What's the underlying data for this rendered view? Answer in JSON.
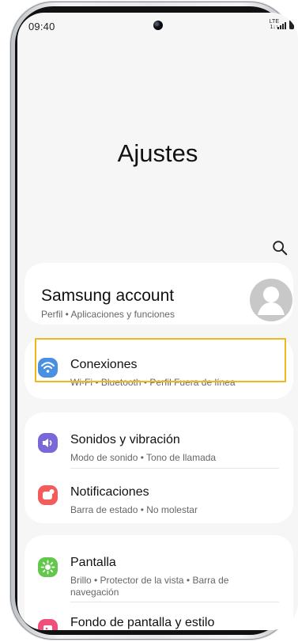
{
  "status_bar": {
    "time": "09:40",
    "network_label": "LTE",
    "network_sub": "1↓↑",
    "signal_icon": "signal-icon",
    "battery_icon": "battery-icon"
  },
  "header": {
    "title": "Ajustes"
  },
  "account": {
    "title": "Samsung account",
    "subtitle": "Perfil • Aplicaciones y funciones",
    "avatar_icon": "avatar-icon"
  },
  "settings": {
    "connections": {
      "title": "Conexiones",
      "subtitle": "Wi-Fi • Bluetooth • Perfil Fuera de línea",
      "icon": "wifi-icon",
      "color": "#4a90e2"
    },
    "sounds": {
      "title": "Sonidos y vibración",
      "subtitle": "Modo de sonido • Tono de llamada",
      "icon": "speaker-icon",
      "color": "#7a67d8"
    },
    "notifications": {
      "title": "Notificaciones",
      "subtitle": "Barra de estado • No molestar",
      "icon": "notification-icon",
      "color": "#f45b5b"
    },
    "display": {
      "title": "Pantalla",
      "subtitle_line1": "Brillo • Protector de la vista • Barra de",
      "subtitle_line2": "navegación",
      "icon": "brightness-icon",
      "color": "#62c84b"
    },
    "wallpaper": {
      "title": "Fondo de pantalla y estilo",
      "icon": "wallpaper-icon",
      "color": "#ef4f7b"
    }
  },
  "highlight": {
    "color": "#f1b71d"
  }
}
